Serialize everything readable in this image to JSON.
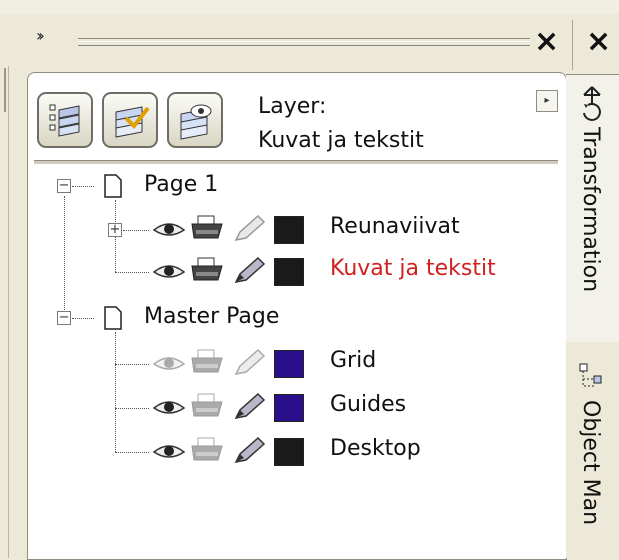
{
  "docker": {
    "close_label": "×",
    "expand_label": "››"
  },
  "layer_header": {
    "label": "Layer:",
    "current_layer": "Kuvat ja tekstit"
  },
  "tree": {
    "page1": {
      "label": "Page 1",
      "layers": [
        {
          "name": "Reunaviivat",
          "color": "#1a1a1a",
          "visible": true,
          "printable": true,
          "editable": false,
          "active": false
        },
        {
          "name": "Kuvat ja tekstit",
          "color": "#1a1a1a",
          "visible": true,
          "printable": true,
          "editable": true,
          "active": true
        }
      ]
    },
    "master": {
      "label": "Master Page",
      "layers": [
        {
          "name": "Grid",
          "color": "#2a0f8a",
          "visible": false,
          "printable": false,
          "editable": false
        },
        {
          "name": "Guides",
          "color": "#2a0f8a",
          "visible": true,
          "printable": false,
          "editable": true
        },
        {
          "name": "Desktop",
          "color": "#1a1a1a",
          "visible": true,
          "printable": false,
          "editable": true
        }
      ]
    }
  },
  "tabs": {
    "transformation": "Transformation",
    "object_manager": "Object Man"
  },
  "colors": {
    "active_layer_text": "#d02020",
    "panel_bg": "#ece9d8"
  }
}
